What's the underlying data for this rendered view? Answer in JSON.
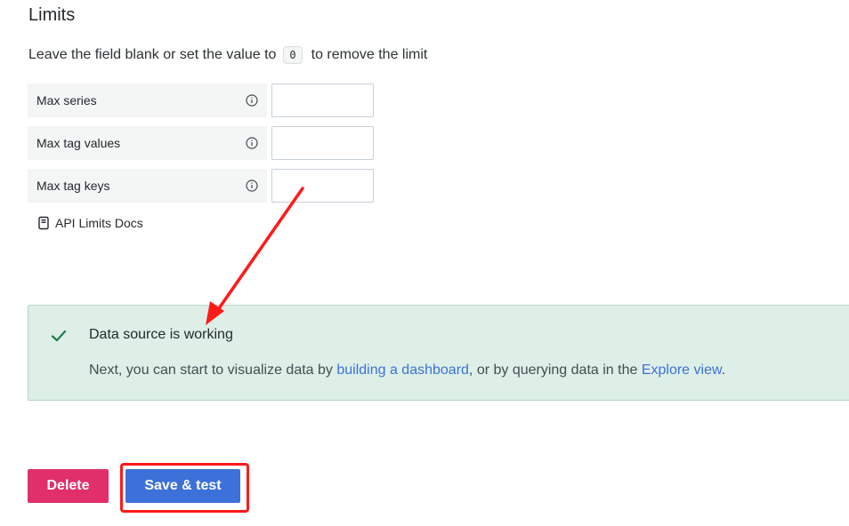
{
  "limits": {
    "title": "Limits",
    "description_before": "Leave the field blank or set the value to",
    "description_code": "0",
    "description_after": "to remove the limit",
    "fields": [
      {
        "label": "Max series",
        "value": ""
      },
      {
        "label": "Max tag values",
        "value": ""
      },
      {
        "label": "Max tag keys",
        "value": ""
      }
    ],
    "docs_link": "API Limits Docs"
  },
  "alert": {
    "title": "Data source is working",
    "body_prefix": "Next, you can start to visualize data by ",
    "link1": "building a dashboard",
    "body_middle": ", or by querying data in the ",
    "link2": "Explore view",
    "body_suffix": ".",
    "color": "#ddefe6"
  },
  "buttons": {
    "delete_label": "Delete",
    "save_label": "Save & test",
    "delete_color": "#e02f6b",
    "save_color": "#3d71d9"
  },
  "annotation": {
    "color": "#ff1a1a"
  }
}
